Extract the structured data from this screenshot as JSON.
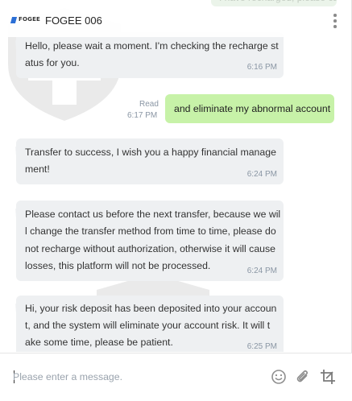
{
  "header": {
    "logo_text": "FOGEE",
    "title": "FOGEE 006",
    "partial_message": "I have recharged, please call you processed immediately",
    "menu_icon": "more-vertical-icon"
  },
  "messages": [
    {
      "direction": "in",
      "lines": [
        "Hello, please wait a moment. I'm checking the recharge st",
        "atus for you."
      ],
      "time": "6:16 PM"
    },
    {
      "direction": "out",
      "text": "and eliminate my abnormal account",
      "status": "Read",
      "time": "6:17 PM"
    },
    {
      "direction": "in",
      "lines": [
        "Transfer to success, I wish you a happy financial manage",
        "ment!"
      ],
      "time": "6:24 PM"
    },
    {
      "direction": "in",
      "lines": [
        "Please contact us before the next transfer, because we wil",
        "l change the transfer method from time to time, please do",
        "not recharge without authorization, otherwise it will cause",
        "losses, this platform will not be processed."
      ],
      "time": "6:24 PM"
    },
    {
      "direction": "in",
      "lines": [
        "Hi, your risk deposit has been deposited into your accoun",
        "t, and the system will eliminate your account risk. It will t",
        "ake some time, please be patient."
      ],
      "time": "6:25 PM"
    }
  ],
  "composer": {
    "placeholder": "Please enter a message.",
    "icons": [
      "emoji-icon",
      "attachment-icon",
      "screenshot-crop-icon"
    ]
  },
  "colors": {
    "incoming_bubble": "#eef0f2",
    "outgoing_bubble": "#c7f2a8",
    "timestamp": "#8a96a4"
  }
}
